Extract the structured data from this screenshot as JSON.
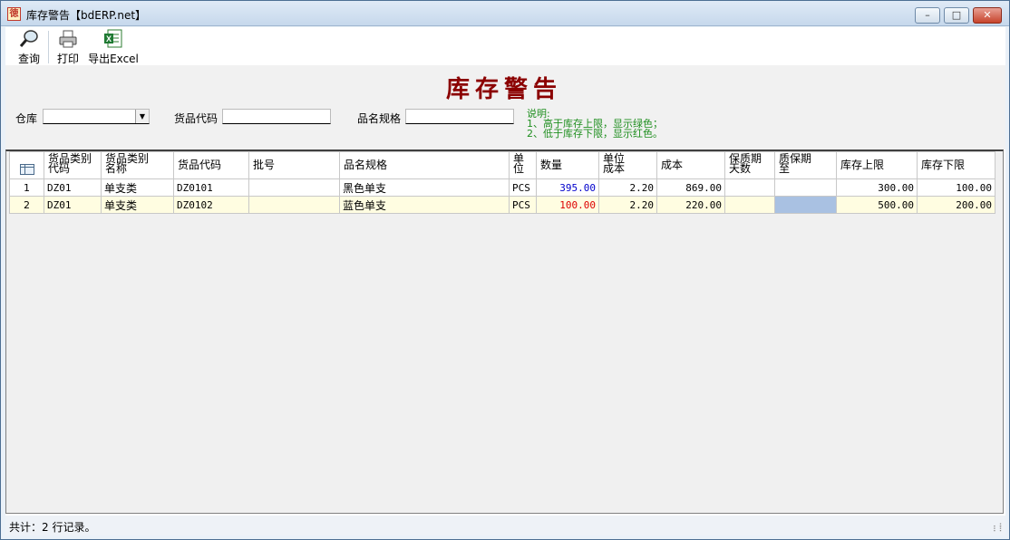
{
  "window": {
    "title": "库存警告【bdERP.net】",
    "app_icon_glyph": "徳"
  },
  "toolbar": {
    "items": [
      {
        "label": "查询",
        "icon": "magnifier-icon"
      },
      {
        "label": "打印",
        "icon": "printer-icon"
      },
      {
        "label": "导出Excel",
        "icon": "excel-icon"
      }
    ]
  },
  "report": {
    "title": "库存警告"
  },
  "filters": {
    "warehouse_label": "仓库",
    "warehouse_value": "",
    "code_label": "货品代码",
    "code_value": "",
    "spec_label": "品名规格",
    "spec_value": ""
  },
  "note": {
    "title": "说明:",
    "line1": "1、高于库存上限，显示绿色；",
    "line2": "2、低于库存下限，显示红色。"
  },
  "colors": {
    "title_red": "#8b0000",
    "note_green": "#1e8e1e",
    "qty_high": "#0000cc",
    "qty_low": "#dd0000",
    "row_alt": "#fffde1"
  },
  "grid": {
    "columns": [
      "货品类别\n代码",
      "货品类别\n名称",
      "货品代码",
      "批号",
      "品名规格",
      "单\n位",
      "数量",
      "单位\n成本",
      "成本",
      "保质期\n天数",
      "质保期\n至",
      "库存上限",
      "库存下限"
    ],
    "rows": [
      {
        "no": "1",
        "cat_code": "DZ01",
        "cat_name": "单支类",
        "code": "DZ0101",
        "batch": "",
        "spec": "黑色单支",
        "unit": "PCS",
        "qty": "395.00",
        "unit_cost": "2.20",
        "cost": "869.00",
        "shelf_days": "",
        "expiry": "",
        "upper": "300.00",
        "lower": "100.00"
      },
      {
        "no": "2",
        "cat_code": "DZ01",
        "cat_name": "单支类",
        "code": "DZ0102",
        "batch": "",
        "spec": "蓝色单支",
        "unit": "PCS",
        "qty": "100.00",
        "unit_cost": "2.20",
        "cost": "220.00",
        "shelf_days": "",
        "expiry": "",
        "upper": "500.00",
        "lower": "200.00"
      }
    ]
  },
  "status": {
    "text": "共计：2 行记录。"
  }
}
